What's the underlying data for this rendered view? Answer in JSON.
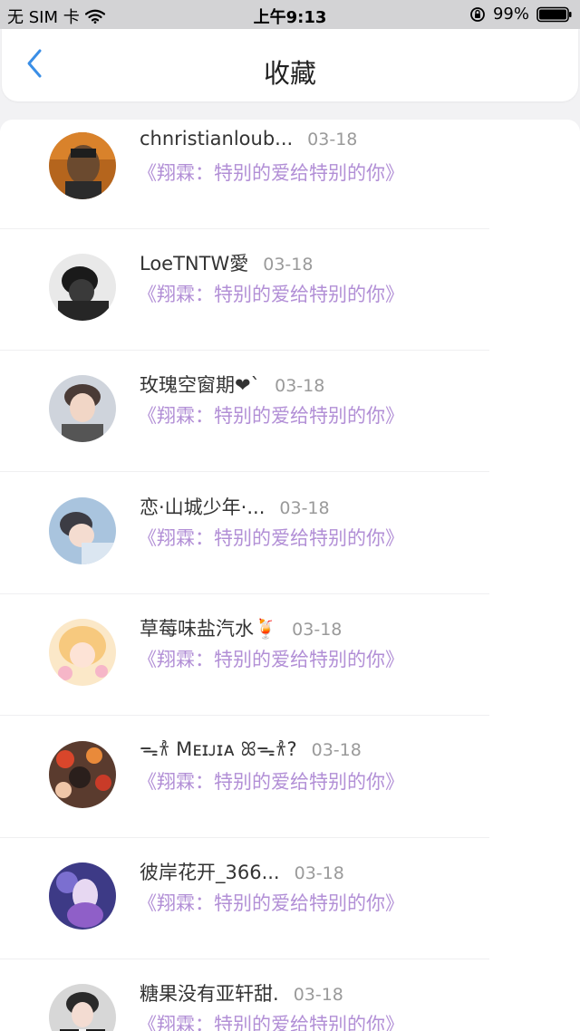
{
  "status_bar": {
    "carrier": "无 SIM 卡",
    "time": "上午9:13",
    "battery": "99%"
  },
  "nav": {
    "title": "收藏"
  },
  "items": [
    {
      "name": "chnristianloub...",
      "date": "03-18",
      "link": "《翔霖：特别的爱给特别的你》"
    },
    {
      "name": "LoeTNTW愛",
      "date": "03-18",
      "link": "《翔霖：特别的爱给特别的你》"
    },
    {
      "name": "玫瑰空窗期❤︎`",
      "date": "03-18",
      "link": "《翔霖：特别的爱给特别的你》"
    },
    {
      "name": "恋·山城少年·...",
      "date": "03-18",
      "link": "《翔霖：特别的爱给特别的你》"
    },
    {
      "name": "草莓味盐汽水🍹",
      "date": "03-18",
      "link": "《翔霖：特别的爱给特别的你》"
    },
    {
      "name": "ᯓ𐀪 Mᴇɪᴊɪᴀ ꕤᯓ𐀪?",
      "date": "03-18",
      "link": "《翔霖：特别的爱给特别的你》"
    },
    {
      "name": "彼岸花开_366...",
      "date": "03-18",
      "link": "《翔霖：特别的爱给特别的你》"
    },
    {
      "name": "糖果没有亚轩甜.",
      "date": "03-18",
      "link": "《翔霖：特别的爱给特别的你》"
    }
  ],
  "colors": {
    "accent": "#3a8ee6",
    "link": "#b28fd6",
    "date": "#9a9a9a"
  }
}
